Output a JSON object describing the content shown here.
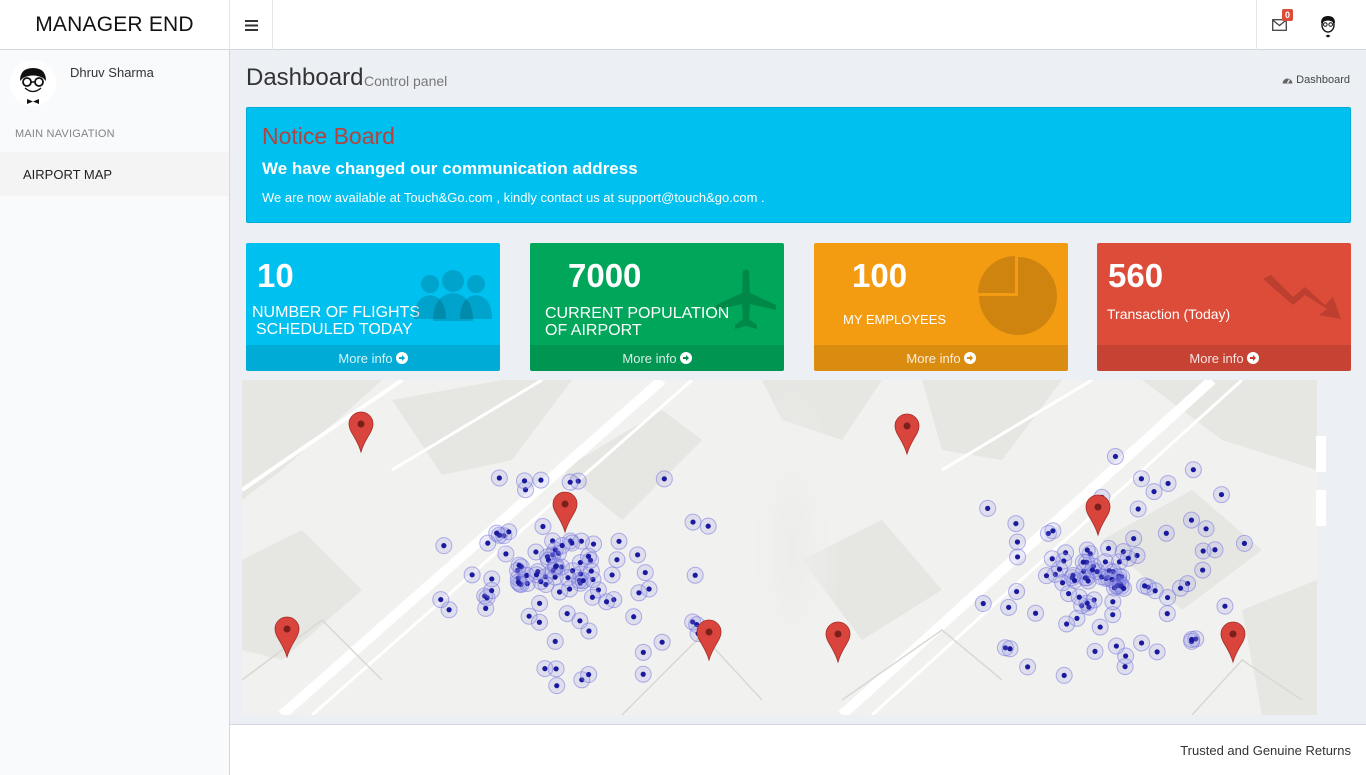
{
  "brand": "MANAGER END",
  "header": {
    "mail_count": "0"
  },
  "sidebar": {
    "user_name": "Dhruv Sharma",
    "nav_header": "MAIN NAVIGATION",
    "items": [
      {
        "label": "AIRPORT MAP"
      }
    ]
  },
  "content_header": {
    "title": "Dashboard",
    "subtitle": "Control panel",
    "breadcrumb": "Dashboard"
  },
  "notice": {
    "title": "Notice Board",
    "headline": "We have changed our communication address",
    "body": "We are now available at Touch&Go.com , kindly contact us at support@touch&go.com ."
  },
  "stats": [
    {
      "value": "10",
      "label_line1": "NUMBER OF FLIGHTS",
      "label_line2": "SCHEDULED TODAY",
      "footer": "More info",
      "color": "#00c0ef",
      "icon": "users-icon"
    },
    {
      "value": "7000",
      "label_line1": "CURRENT POPULATION",
      "label_line2": "OF AIRPORT",
      "footer": "More info",
      "color": "#00a65a",
      "icon": "plane-icon"
    },
    {
      "value": "100",
      "label_line1": "MY EMPLOYEES",
      "label_line2": "",
      "footer": "More info",
      "color": "#f39c12",
      "icon": "pie-chart-icon"
    },
    {
      "value": "560",
      "label_line1": "Transaction (Today)",
      "label_line2": "",
      "footer": "More info",
      "color": "#dd4b39",
      "icon": "trend-down-icon"
    }
  ],
  "footer": {
    "text": "Trusted and Genuine Returns"
  },
  "map": {
    "marker_color": "#d9453d",
    "cluster_color": "#1a1a9e"
  }
}
